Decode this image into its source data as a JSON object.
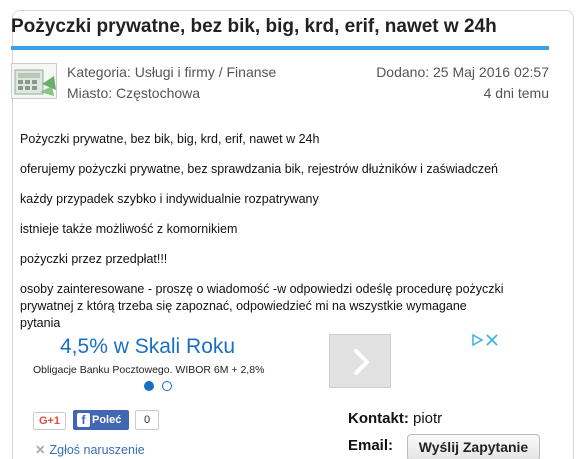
{
  "listing": {
    "title": "Pożyczki prywatne, bez bik, big, krd, erif, nawet w 24h",
    "category": "Kategoria: Usługi i firmy / Finanse",
    "city": "Miasto: Częstochowa",
    "date": "Dodano: 25 Maj 2016 02:57",
    "age": "4 dni temu"
  },
  "body": {
    "p1": "Pożyczki prywatne, bez bik, big, krd, erif, nawet w 24h",
    "p2": "oferujemy pożyczki prywatne, bez sprawdzania bik, rejestrów dłużników i zaświadczeń",
    "p3": "każdy przypadek szybko i indywidualnie rozpatrywany",
    "p4": "istnieje także możliwość z komornikiem",
    "p5": "pożyczki przez przedpłat!!!",
    "p6_line1": "osoby zainteresowane - proszę o wiadomość -w odpowiedzi odeślę procedurę pożyczki",
    "p6_line2": "prywatnej z którą trzeba się zapoznać, odpowiedzieć mi na wszystkie wymagane pytania"
  },
  "ad": {
    "headline": "4,5% w Skali Roku",
    "subline": "Obligacje Banku Pocztowego. WIBOR 6M + 2,8%",
    "accent": "#1a6fc4"
  },
  "social": {
    "gplus_label": "G+1",
    "fb_label": "Poleć",
    "fb_count": "0"
  },
  "report_label": "Zgłoś naruszenie",
  "contact": {
    "label": "Kontakt:",
    "name": "piotr",
    "email_label": "Email:",
    "send_button": "Wyślij Zapytanie"
  },
  "colors": {
    "title_rule": "#3aa0e6",
    "link": "#3a6fb0",
    "facebook": "#4267b2"
  }
}
